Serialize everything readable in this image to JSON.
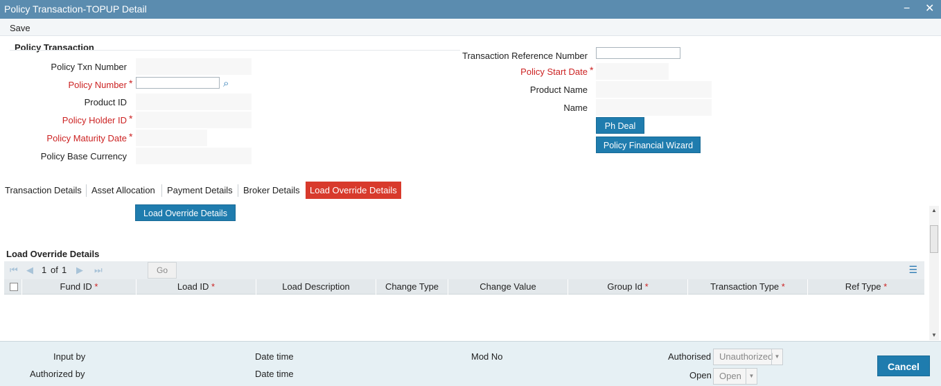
{
  "window": {
    "title": "Policy Transaction-TOPUP Detail",
    "minimize": "−",
    "close": "✕"
  },
  "toolbar": {
    "save_label": "Save"
  },
  "section": {
    "title": "Policy Transaction"
  },
  "left_fields": {
    "policy_txn_number": "Policy Txn Number",
    "policy_number": "Policy Number",
    "product_id": "Product ID",
    "policy_holder_id": "Policy Holder ID",
    "policy_maturity_date": "Policy Maturity Date",
    "policy_base_currency": "Policy Base Currency"
  },
  "right_fields": {
    "transaction_reference_number": "Transaction Reference Number",
    "policy_start_date": "Policy Start Date",
    "product_name": "Product Name",
    "name": "Name"
  },
  "required_mark": "*",
  "buttons": {
    "ph_deal": "Ph Deal",
    "policy_financial_wizard": "Policy Financial Wizard",
    "load_override_details": "Load Override Details"
  },
  "tabs": [
    "Transaction Details",
    "Asset Allocation",
    "Payment Details",
    "Broker Details",
    "Load Override Details"
  ],
  "grid": {
    "title": "Load Override Details",
    "pager": {
      "current": "1",
      "of_label": "of",
      "total": "1",
      "go_label": "Go"
    },
    "columns": [
      "Fund ID",
      "Load ID",
      "Load Description",
      "Change Type",
      "Change Value",
      "Group Id",
      "Transaction Type",
      "Ref Type"
    ]
  },
  "footer": {
    "input_by": "Input by",
    "authorized_by": "Authorized by",
    "date_time_1": "Date time",
    "date_time_2": "Date time",
    "mod_no": "Mod No",
    "authorised_label": "Authorised",
    "authorised_value": "Unauthorized",
    "open_label": "Open",
    "open_value": "Open",
    "cancel_label": "Cancel"
  },
  "colors": {
    "titlebar": "#5b8caf",
    "button": "#1f7cae",
    "active_tab": "#d83a2c",
    "required": "#cc2222"
  }
}
